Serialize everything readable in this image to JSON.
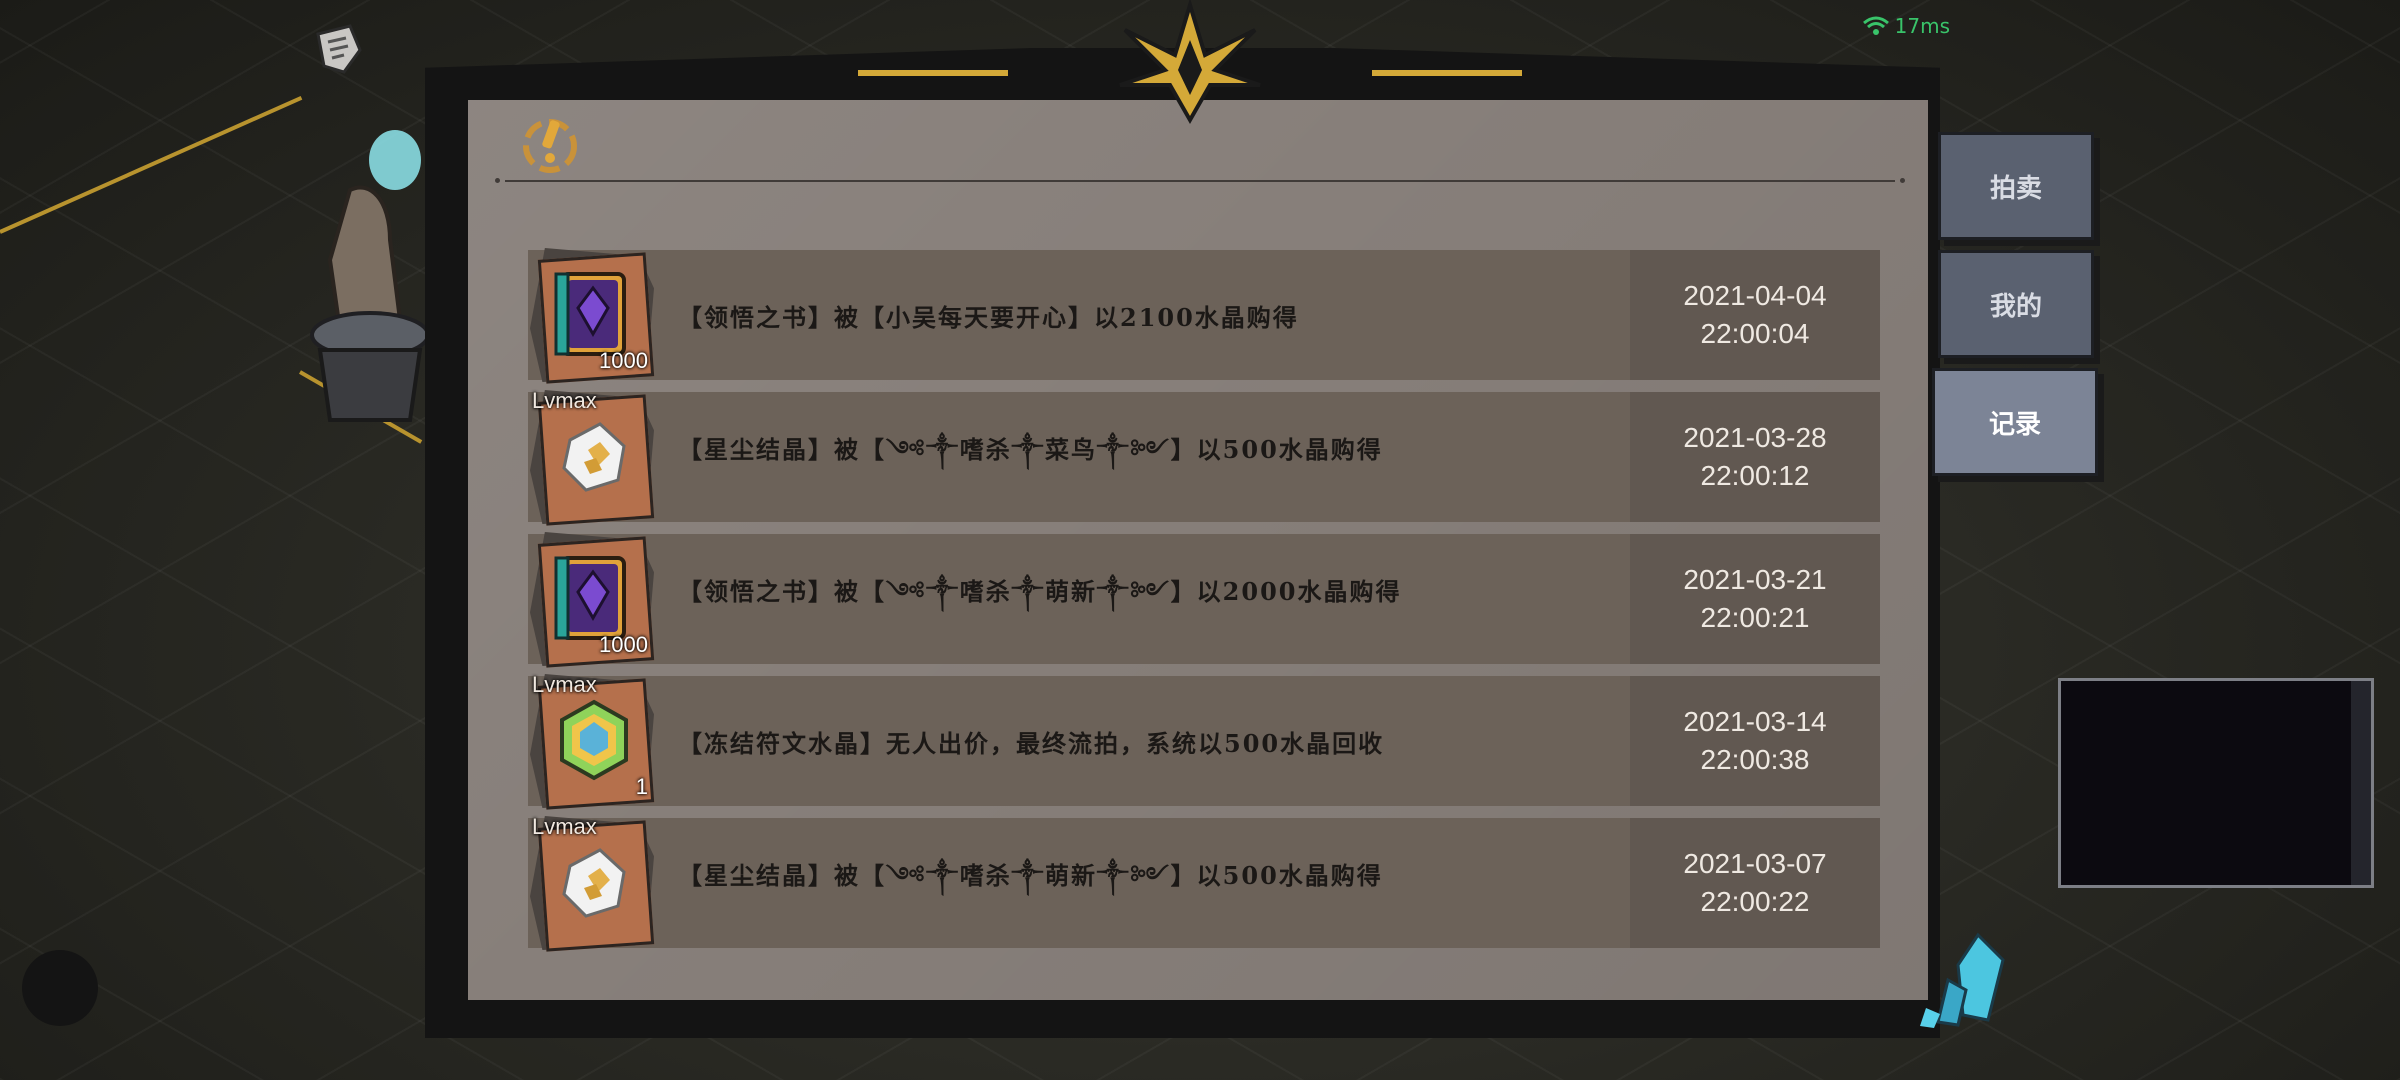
{
  "status": {
    "latency": "17ms",
    "wifi_color": "#39c46a"
  },
  "tabs": [
    {
      "label": "拍卖",
      "active": false
    },
    {
      "label": "我的",
      "active": false
    },
    {
      "label": "记录",
      "active": true
    }
  ],
  "records": [
    {
      "item": "tome-icon",
      "count": "1000",
      "lvmax": "",
      "text": "【领悟之书】被【小吴每天要开心】以2100水晶购得",
      "date": "2021-04-04",
      "time": "22:00:04"
    },
    {
      "item": "star-crystal-icon",
      "count": "",
      "lvmax": "Lvmax",
      "text": "【星尘结晶】被【༺༒嗜杀༒菜鸟༒༻】以500水晶购得",
      "date": "2021-03-28",
      "time": "22:00:12"
    },
    {
      "item": "tome-icon",
      "count": "1000",
      "lvmax": "",
      "text": "【领悟之书】被【༺༒嗜杀༒萌新༒༻】以2000水晶购得",
      "date": "2021-03-21",
      "time": "22:00:21"
    },
    {
      "item": "rune-crystal-icon",
      "count": "1",
      "lvmax": "Lvmax",
      "text": "【冻结符文水晶】无人出价，最终流拍，系统以500水晶回收",
      "date": "2021-03-14",
      "time": "22:00:38"
    },
    {
      "item": "star-crystal-icon",
      "count": "",
      "lvmax": "Lvmax",
      "text": "【星尘结晶】被【༺༒嗜杀༒萌新༒༻】以500水晶购得",
      "date": "2021-03-07",
      "time": "22:00:22"
    }
  ],
  "colors": {
    "panel": "#877f7a",
    "row": "#6c6259",
    "tab": "#5a6170",
    "tab_active": "#7c8496",
    "gold": "#d4a938"
  }
}
